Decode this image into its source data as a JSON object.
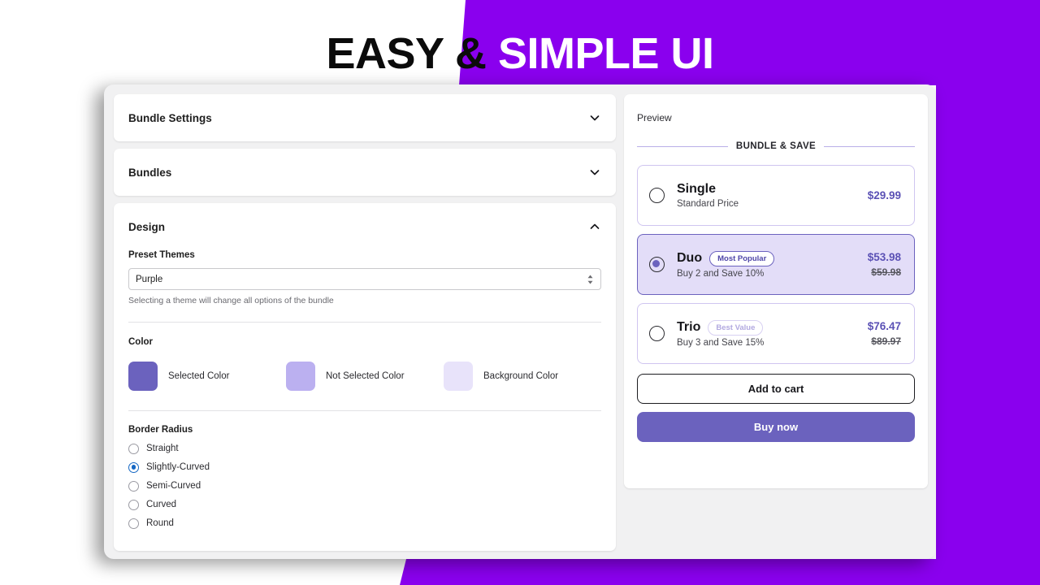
{
  "headline": {
    "dark_part": "EASY &",
    "light_part": "SIMPLE UI"
  },
  "colors": {
    "brand_purple": "#8a00ee",
    "accent_purple": "#6b62be",
    "selected_color": "#6b62be",
    "not_selected_color": "#bbb0f0",
    "background_color": "#e8e3fa",
    "radio_blue": "#1668c4"
  },
  "settings": {
    "sections": [
      {
        "title": "Bundle Settings",
        "icon": "chevron-down-icon",
        "expanded": false
      },
      {
        "title": "Bundles",
        "icon": "chevron-down-icon",
        "expanded": false
      },
      {
        "title": "Design",
        "icon": "chevron-up-icon",
        "expanded": true
      }
    ],
    "design": {
      "preset_themes": {
        "label": "Preset Themes",
        "selected": "Purple",
        "options": [
          "Purple"
        ],
        "helper": "Selecting a theme will change all options of the bundle"
      },
      "color": {
        "label": "Color",
        "swatches": [
          {
            "label": "Selected Color",
            "hex": "#6b62be"
          },
          {
            "label": "Not Selected Color",
            "hex": "#bbb0f0"
          },
          {
            "label": "Background Color",
            "hex": "#e8e3fa"
          }
        ]
      },
      "border_radius": {
        "label": "Border Radius",
        "options": [
          {
            "label": "Straight",
            "checked": false
          },
          {
            "label": "Slightly-Curved",
            "checked": true
          },
          {
            "label": "Semi-Curved",
            "checked": false
          },
          {
            "label": "Curved",
            "checked": false
          },
          {
            "label": "Round",
            "checked": false
          }
        ]
      }
    }
  },
  "preview": {
    "label": "Preview",
    "bundle_heading": "BUNDLE & SAVE",
    "options": [
      {
        "title": "Single",
        "badge": "",
        "subtitle": "Standard Price",
        "price": "$29.99",
        "old_price": "",
        "selected": false
      },
      {
        "title": "Duo",
        "badge": "Most Popular",
        "subtitle": "Buy 2 and Save 10%",
        "price": "$53.98",
        "old_price": "$59.98",
        "selected": true
      },
      {
        "title": "Trio",
        "badge": "Best Value",
        "subtitle": "Buy 3 and Save 15%",
        "price": "$76.47",
        "old_price": "$89.97",
        "selected": false
      }
    ],
    "add_to_cart_label": "Add to cart",
    "buy_now_label": "Buy now"
  }
}
